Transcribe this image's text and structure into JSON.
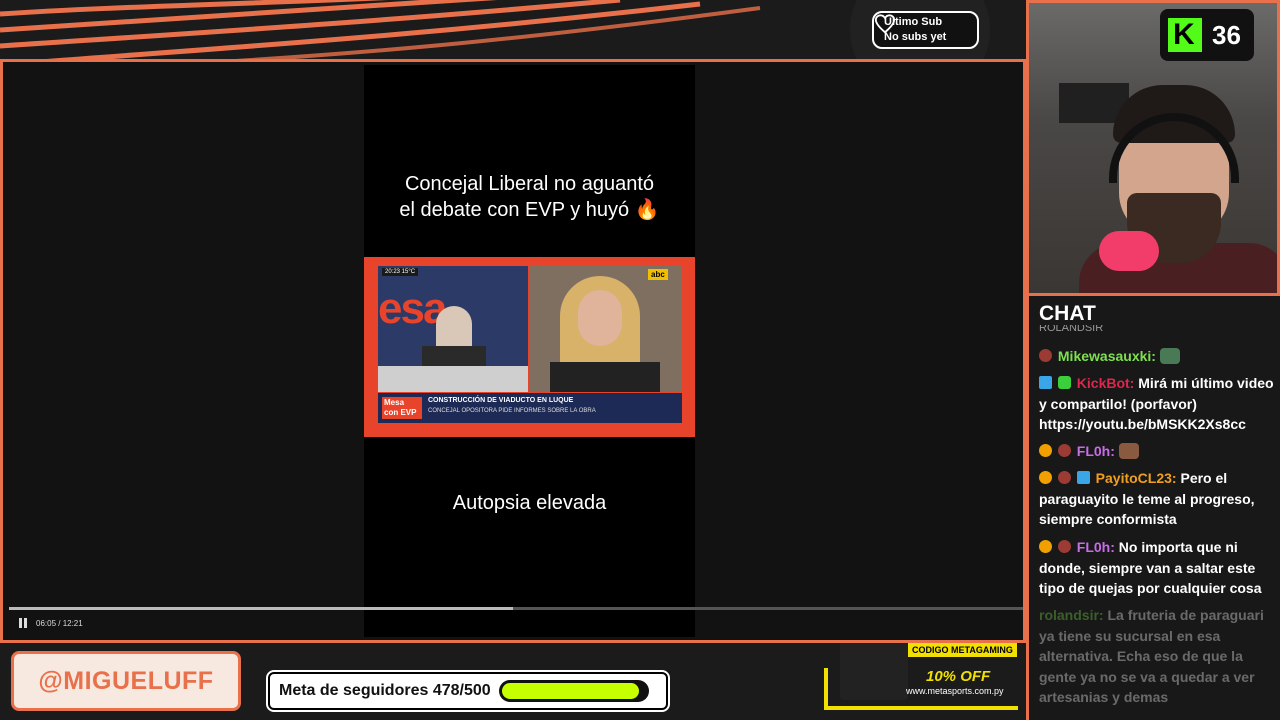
{
  "top_bar": {
    "last_sub_title": "Último Sub",
    "last_sub_value": "No subs yet"
  },
  "video": {
    "caption_top_line1": "Concejal Liberal no aguantó",
    "caption_top_line2": "el debate con EVP y huyó 🔥",
    "caption_bottom": "Autopsia elevada",
    "news_time": "20:23  15°C",
    "news_channel": "abc",
    "news_program": "Mesa con EVP",
    "news_headline": "CONSTRUCCIÓN DE VIADUCTO EN LUQUE",
    "news_subheadline": "CONCEJAL OPOSITORA PIDE INFORMES SOBRE LA OBRA",
    "time_display": "06:05 / 12:21",
    "progress_fraction": 0.4966
  },
  "bottom_bar": {
    "handle": "@MIGUELUFF",
    "goal_label": "Meta de seguidores 478/500",
    "goal_fraction": 0.956,
    "sponsor_code_prefix": "CODIGO ",
    "sponsor_code": "METAGAMING",
    "sponsor_discount": "10% OFF",
    "sponsor_site": "www.metasports.com.py"
  },
  "cam": {
    "viewer_count": "36",
    "kick_letter": "K"
  },
  "chat": {
    "title": "CHAT",
    "messages": [
      {
        "user": "Mikewasauxki:",
        "text": ""
      },
      {
        "user": "KickBot:",
        "text": "Mirá mi último video y compartilo! (porfavor) https://youtu.be/bMSKK2Xs8cc"
      },
      {
        "user": "FL0h:",
        "text": ""
      },
      {
        "user": "PayitoCL23:",
        "text": "Pero el paraguayito le teme al progreso, siempre conformista"
      },
      {
        "user": "FL0h:",
        "text": "No importa que ni donde, siempre van a saltar este tipo de quejas por cualquier cosa"
      },
      {
        "user": "rolandsir:",
        "text": "La fruteria de paraguari ya tiene su sucursal en esa alternativa. Echa eso de que la gente ya no se va a quedar a ver artesanias y demas"
      }
    ]
  },
  "colors": {
    "accent": "#e8704a",
    "kick_green": "#53fc18",
    "goal_fill": "#c6ff00",
    "sponsor_yellow": "#f2e000"
  }
}
